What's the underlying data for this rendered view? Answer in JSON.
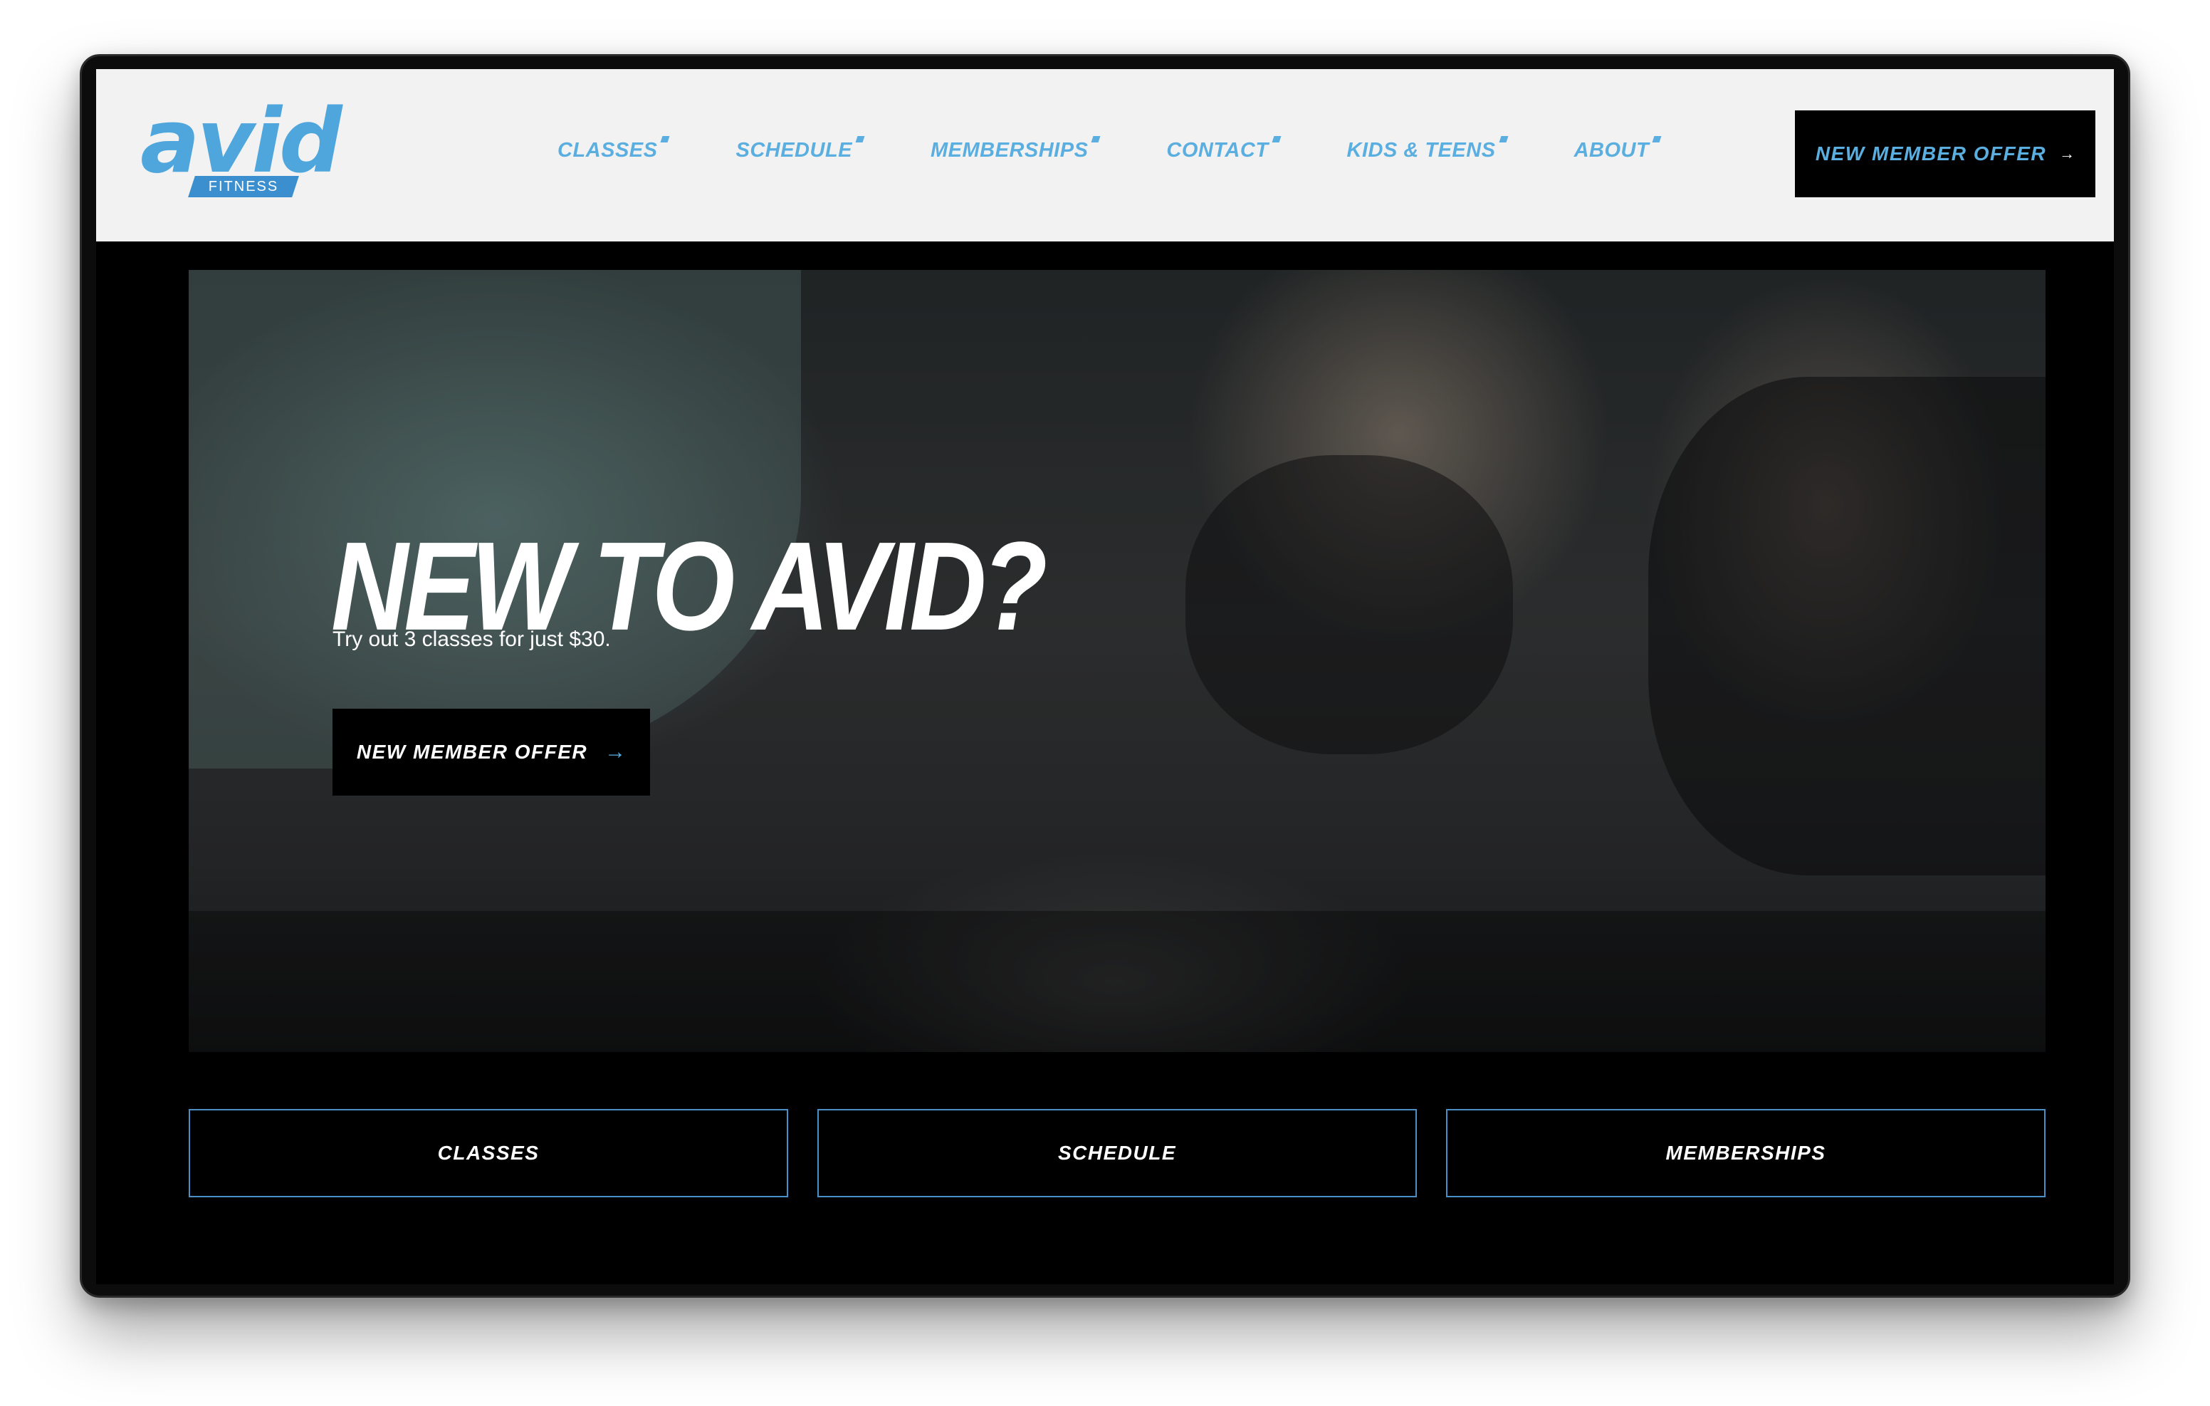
{
  "brand": {
    "logo_word": "avid",
    "logo_tag": "FITNESS"
  },
  "nav": {
    "items": [
      {
        "label": "CLASSES"
      },
      {
        "label": "SCHEDULE"
      },
      {
        "label": "MEMBERSHIPS"
      },
      {
        "label": "CONTACT"
      },
      {
        "label": "KIDS & TEENS"
      },
      {
        "label": "ABOUT"
      }
    ],
    "cta_label": "NEW MEMBER OFFER",
    "cta_icon": "arrow-right-icon"
  },
  "hero": {
    "title": "NEW TO AVID?",
    "subtitle": "Try out 3 classes for just $30.",
    "cta_label": "NEW MEMBER OFFER",
    "cta_icon": "arrow-right-icon"
  },
  "tiles": [
    {
      "label": "CLASSES"
    },
    {
      "label": "SCHEDULE"
    },
    {
      "label": "MEMBERSHIPS"
    }
  ],
  "colors": {
    "accent": "#5aaee0",
    "header_bg": "#f2f2f2",
    "page_bg": "#000000",
    "tile_border": "#4a90c8"
  }
}
